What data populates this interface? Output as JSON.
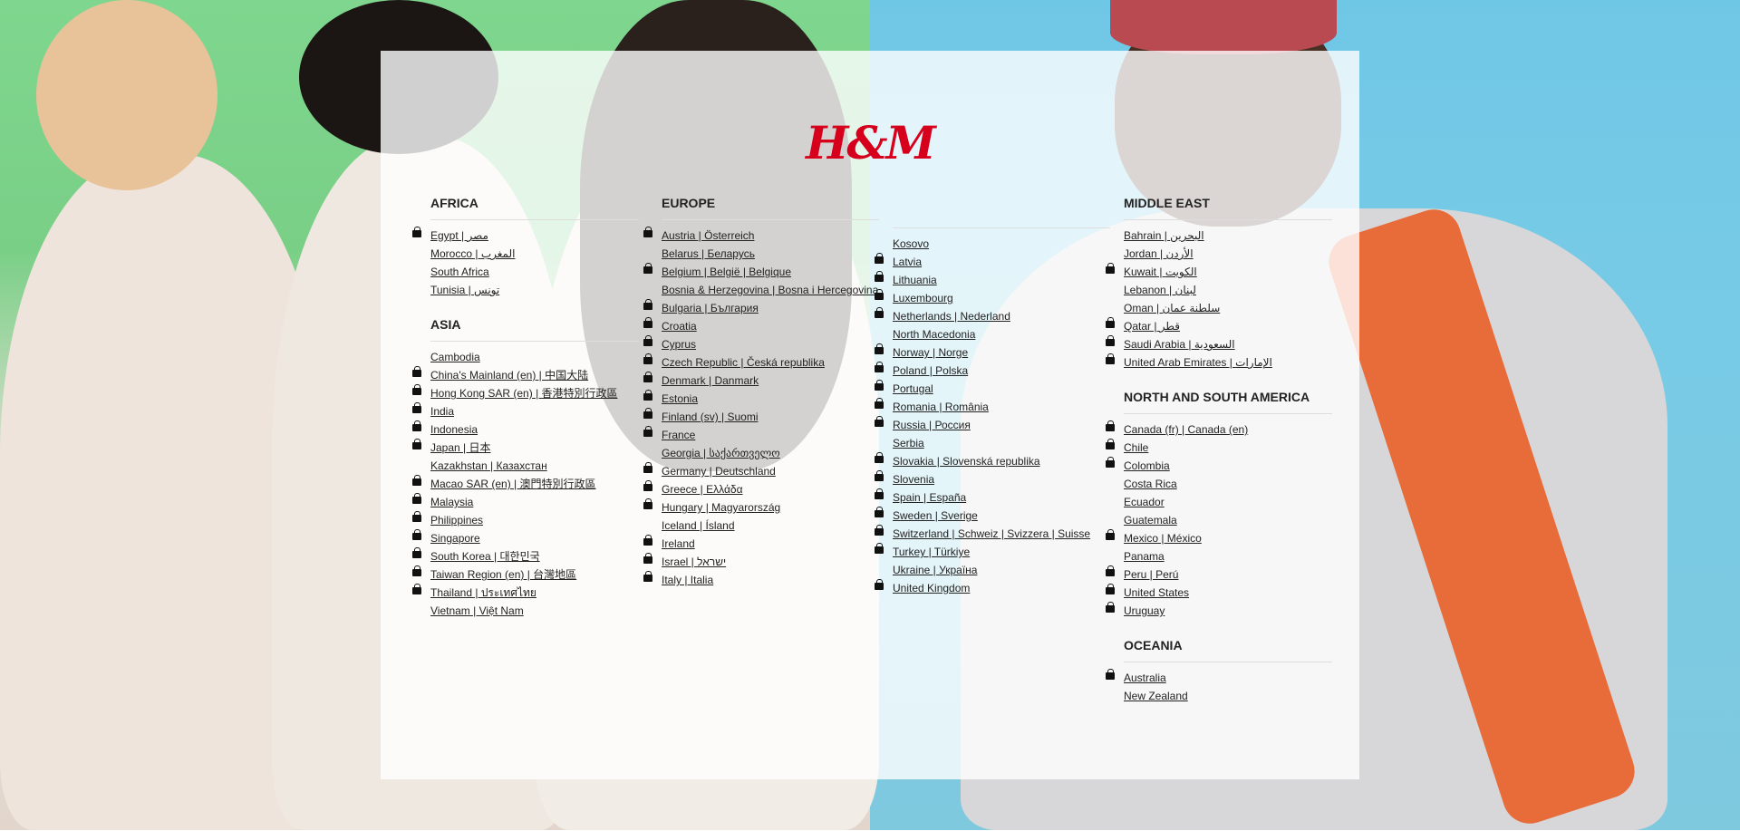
{
  "brand": {
    "logo_text": "H&M"
  },
  "regions": {
    "africa": {
      "title": "AFRICA",
      "items": [
        {
          "label": "Egypt | مصر",
          "bag": true
        },
        {
          "label": "Morocco | المغرب",
          "bag": false
        },
        {
          "label": "South Africa",
          "bag": false
        },
        {
          "label": "Tunisia | تونس",
          "bag": false
        }
      ]
    },
    "asia": {
      "title": "ASIA",
      "items": [
        {
          "label": "Cambodia",
          "bag": false
        },
        {
          "label": "China's Mainland (en) | 中国大陆",
          "bag": true
        },
        {
          "label": "Hong Kong SAR (en) | 香港特別行政區",
          "bag": true
        },
        {
          "label": "India",
          "bag": true
        },
        {
          "label": "Indonesia",
          "bag": true
        },
        {
          "label": "Japan | 日本",
          "bag": true
        },
        {
          "label": "Kazakhstan | Казахстан",
          "bag": false
        },
        {
          "label": "Macao SAR (en) | 澳門特別行政區",
          "bag": true
        },
        {
          "label": "Malaysia",
          "bag": true
        },
        {
          "label": "Philippines",
          "bag": true
        },
        {
          "label": "Singapore",
          "bag": true
        },
        {
          "label": "South Korea | 대한민국",
          "bag": true
        },
        {
          "label": "Taiwan Region (en) | 台灣地區",
          "bag": true
        },
        {
          "label": "Thailand | ประเทศไทย",
          "bag": true
        },
        {
          "label": "Vietnam | Việt Nam",
          "bag": false
        }
      ]
    },
    "europe": {
      "title": "EUROPE",
      "items_a": [
        {
          "label": "Austria | Österreich",
          "bag": true
        },
        {
          "label": "Belarus | Беларусь",
          "bag": false
        },
        {
          "label": "Belgium | België | Belgique",
          "bag": true
        },
        {
          "label": "Bosnia & Herzegovina | Bosna i Hercegovina",
          "bag": false
        },
        {
          "label": "Bulgaria | България",
          "bag": true
        },
        {
          "label": "Croatia",
          "bag": true
        },
        {
          "label": "Cyprus",
          "bag": true
        },
        {
          "label": "Czech Republic | Česká republika",
          "bag": true
        },
        {
          "label": "Denmark | Danmark",
          "bag": true
        },
        {
          "label": "Estonia",
          "bag": true
        },
        {
          "label": "Finland (sv) | Suomi",
          "bag": true
        },
        {
          "label": "France",
          "bag": true
        },
        {
          "label": "Georgia | საქართველო",
          "bag": false
        },
        {
          "label": "Germany | Deutschland",
          "bag": true
        },
        {
          "label": "Greece | Ελλάδα",
          "bag": true
        },
        {
          "label": "Hungary | Magyarország",
          "bag": true
        },
        {
          "label": "Iceland | Ísland",
          "bag": false
        },
        {
          "label": "Ireland",
          "bag": true
        },
        {
          "label": "Israel | ישראל",
          "bag": true
        },
        {
          "label": "Italy | Italia",
          "bag": true
        }
      ],
      "items_b": [
        {
          "label": "Kosovo",
          "bag": false
        },
        {
          "label": "Latvia",
          "bag": true
        },
        {
          "label": "Lithuania",
          "bag": true
        },
        {
          "label": "Luxembourg",
          "bag": true
        },
        {
          "label": "Netherlands | Nederland",
          "bag": true
        },
        {
          "label": "North Macedonia",
          "bag": false
        },
        {
          "label": "Norway | Norge",
          "bag": true
        },
        {
          "label": "Poland | Polska",
          "bag": true
        },
        {
          "label": "Portugal",
          "bag": true
        },
        {
          "label": "Romania | România",
          "bag": true
        },
        {
          "label": "Russia | Россия",
          "bag": true
        },
        {
          "label": "Serbia",
          "bag": false
        },
        {
          "label": "Slovakia | Slovenská republika",
          "bag": true
        },
        {
          "label": "Slovenia",
          "bag": true
        },
        {
          "label": "Spain | España",
          "bag": true
        },
        {
          "label": "Sweden | Sverige",
          "bag": true
        },
        {
          "label": "Switzerland | Schweiz | Svizzera | Suisse",
          "bag": true
        },
        {
          "label": "Turkey | Türkiye",
          "bag": true
        },
        {
          "label": "Ukraine | Україна",
          "bag": false
        },
        {
          "label": "United Kingdom",
          "bag": true
        }
      ]
    },
    "middle_east": {
      "title": "MIDDLE EAST",
      "items": [
        {
          "label": "Bahrain | البحرين",
          "bag": false
        },
        {
          "label": "Jordan | الأردن",
          "bag": false
        },
        {
          "label": "Kuwait | الكويت",
          "bag": true
        },
        {
          "label": "Lebanon | لبنان",
          "bag": false
        },
        {
          "label": "Oman | سلطنة عمان",
          "bag": false
        },
        {
          "label": "Qatar | قطر",
          "bag": true
        },
        {
          "label": "Saudi Arabia | السعودية",
          "bag": true
        },
        {
          "label": "United Arab Emirates | الإمارات",
          "bag": true
        }
      ]
    },
    "americas": {
      "title": "NORTH AND SOUTH AMERICA",
      "items": [
        {
          "label": "Canada (fr) | Canada (en)",
          "bag": true
        },
        {
          "label": "Chile",
          "bag": true
        },
        {
          "label": "Colombia",
          "bag": true
        },
        {
          "label": "Costa Rica",
          "bag": false
        },
        {
          "label": "Ecuador",
          "bag": false
        },
        {
          "label": "Guatemala",
          "bag": false
        },
        {
          "label": "Mexico | México",
          "bag": true
        },
        {
          "label": "Panama",
          "bag": false
        },
        {
          "label": "Peru | Perú",
          "bag": true
        },
        {
          "label": "United States",
          "bag": true
        },
        {
          "label": "Uruguay",
          "bag": true
        }
      ]
    },
    "oceania": {
      "title": "OCEANIA",
      "items": [
        {
          "label": "Australia",
          "bag": true
        },
        {
          "label": "New Zealand",
          "bag": false
        }
      ]
    }
  }
}
